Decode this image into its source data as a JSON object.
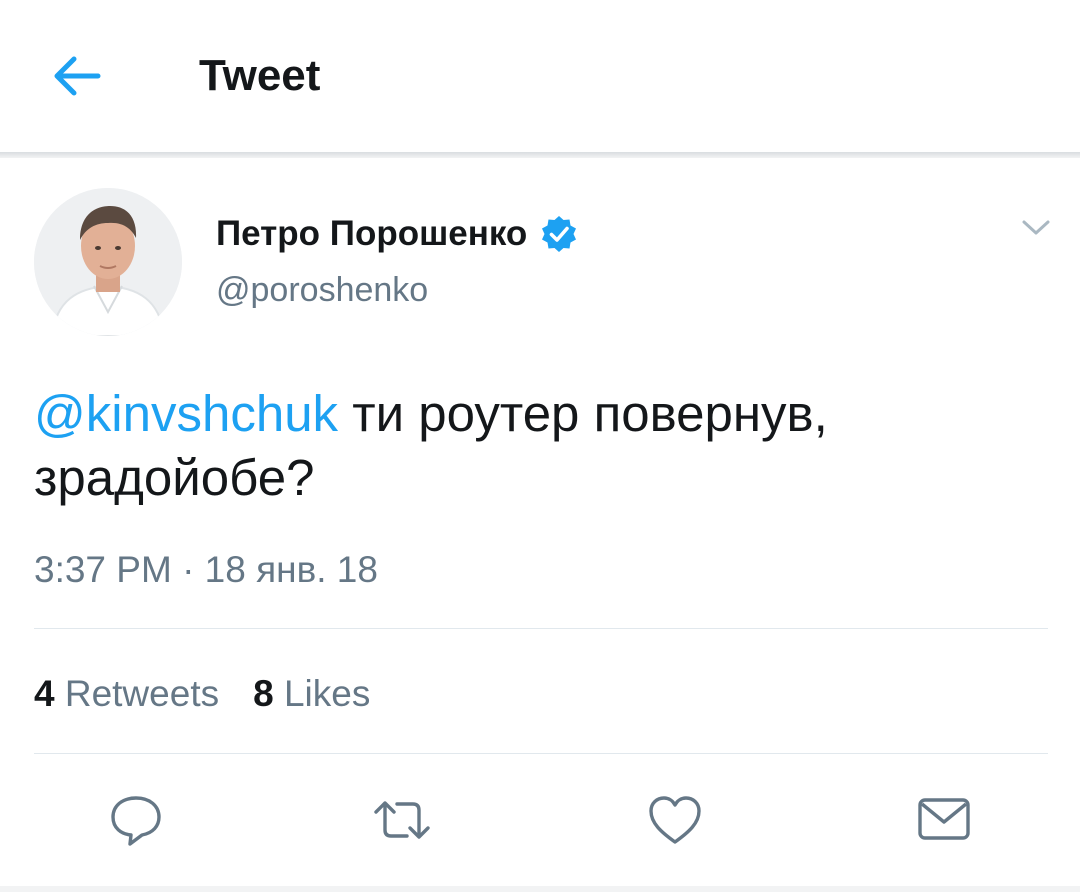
{
  "header": {
    "title": "Tweet",
    "back_icon": "arrow-left-icon"
  },
  "tweet": {
    "author": {
      "display_name": "Петро Порошенко",
      "handle": "@poroshenko",
      "verified": true
    },
    "mention": "@kinvshchuk",
    "text": " ти роутер повернув, зрадойобе?",
    "timestamp": "3:37 PM · 18 янв. 18",
    "stats": {
      "retweets_count": "4",
      "retweets_label": "Retweets",
      "likes_count": "8",
      "likes_label": "Likes"
    },
    "actions": [
      "reply-icon",
      "retweet-icon",
      "like-icon",
      "message-icon"
    ]
  },
  "colors": {
    "accent": "#1da1f2",
    "secondary_text": "#657786",
    "primary_text": "#14171a",
    "divider": "#e1e8ed"
  }
}
